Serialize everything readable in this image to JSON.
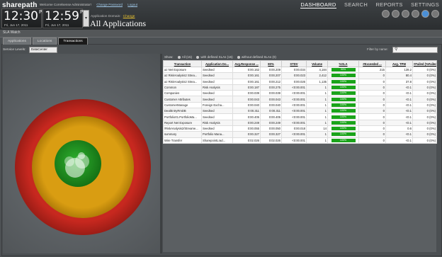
{
  "header": {
    "logo": "sharepath",
    "welcome": "Welcome Correlsense Administrator!",
    "change_password": "Change Password",
    "logout": "Logout",
    "clock1": {
      "time": "12:30",
      "ampm": "PM",
      "date": "Fri, Jun 17, 2011"
    },
    "clock2": {
      "time": "12:59",
      "ampm": "PM",
      "date": "Fri, Jun 17, 2011"
    },
    "app_domain_label": "Application Domain:",
    "app_domain_change": "Change",
    "app_domain_value": "All Applications",
    "nav": [
      "DASHBOARD",
      "SEARCH",
      "REPORTS",
      "SETTINGS"
    ]
  },
  "sla_title": "SLA Watch",
  "tabs": [
    "Applications",
    "Locations",
    "Transactions"
  ],
  "service_levels_label": "Service Levels:",
  "service_levels_value": "DataCenter",
  "show": {
    "label": "Show:",
    "opt_all": "All (15)",
    "opt_with": "with defined SLAs (15)",
    "opt_without": "without defined SLAs (0)"
  },
  "filter_label": "Filter by name:",
  "colors": {
    "red": "#d32b21",
    "orange": "#d89a10",
    "green": "#1e8f1e"
  },
  "table": {
    "columns": [
      "Transaction",
      "Application Do...",
      "Avg.Response ...",
      "80%",
      "STDV",
      "Volume",
      "%SLA",
      "#Exceeded ...",
      "Avg. TPM",
      "#Failed (%Failed)"
    ],
    "rows": [
      [
        "az Net Exposure",
        "Seedsed",
        "0:00.162",
        "0:00.209",
        "0:00.034",
        "4,184",
        "90%",
        "215",
        "139.2",
        "0 (0%)"
      ],
      [
        "az RiskAnalysis2 Strea...",
        "Seedsed",
        "0:00.161",
        "0:00.207",
        "0:00.023",
        "2,412",
        "100%",
        "0",
        "80.4",
        "0 (0%)"
      ],
      [
        "az RiskAnalysis2 Strea...",
        "Seedsed",
        "0:00.161",
        "0:00.212",
        "0:00.026",
        "1,135",
        "100%",
        "0",
        "37.8",
        "0 (0%)"
      ],
      [
        "Common",
        "Risk Analysis",
        "0:00.187",
        "0:00.275",
        "<0:00.001",
        "1",
        "100%",
        "0",
        "<0.1",
        "0 (0%)"
      ],
      [
        "Companies",
        "Seedsed",
        "0:00.039",
        "0:00.039",
        "<0:00.001",
        "1",
        "100%",
        "0",
        "<0.1",
        "0 (0%)"
      ],
      [
        "Customer Attributes",
        "Seedsed",
        "0:00.043",
        "0:00.043",
        "<0:00.001",
        "1",
        "100%",
        "0",
        "<0.1",
        "0 (0%)"
      ],
      [
        "CustomerManage",
        "Foreign Excha...",
        "0:00.040",
        "0:00.040",
        "<0:00.001",
        "1",
        "100%",
        "0",
        "<0.1",
        "0 (0%)"
      ],
      [
        "DealEntryRmDB",
        "Seedsed",
        "0:00.311",
        "0:00.311",
        "<0:00.001",
        "1",
        "100%",
        "0",
        "<0.1",
        "0 (0%)"
      ],
      [
        "Portfolio01.PortfolioMa...",
        "Seedsed",
        "0:00.405",
        "0:00.405",
        "<0:00.001",
        "1",
        "100%",
        "0",
        "<0.1",
        "0 (0%)"
      ],
      [
        "Report Net Exposure",
        "Risk Analysis",
        "0:00.249",
        "0:00.249",
        "<0:00.001",
        "1",
        "100%",
        "0",
        "<0.1",
        "0 (0%)"
      ],
      [
        "/RiskAnalysis2/Streame...",
        "Seedsed",
        "0:00.055",
        "0:00.050",
        "0:00.018",
        "14",
        "100%",
        "0",
        "0.6",
        "0 (0%)"
      ],
      [
        "summary",
        "Portfolio Mana...",
        "0:00.327",
        "0:00.327",
        "<0:00.001",
        "1",
        "100%",
        "0",
        "<0.1",
        "0 (0%)"
      ],
      [
        "Wire Transfer",
        "SharepointLrad...",
        "0:02.026",
        "0:02.026",
        "<0:00.001",
        "1",
        "100%",
        "0",
        "<0.1",
        "0 (0%)"
      ]
    ]
  }
}
